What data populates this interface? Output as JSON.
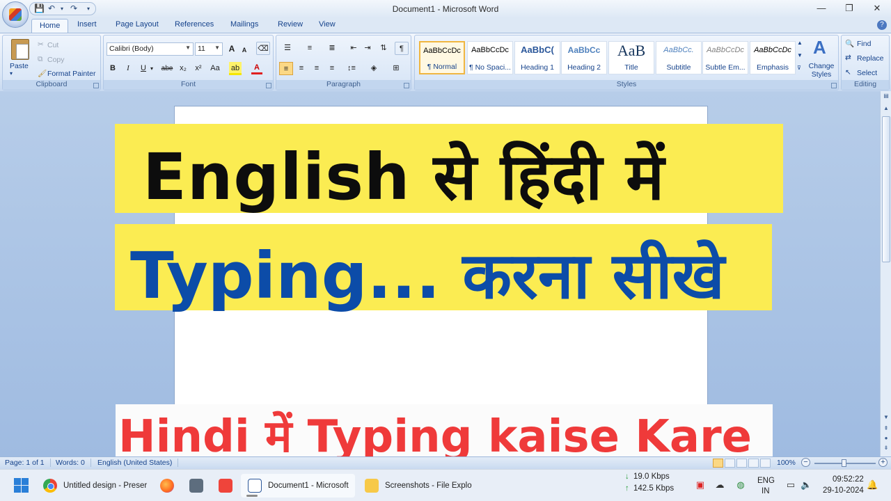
{
  "window": {
    "title": "Document1 - Microsoft Word",
    "minimize_glyph": "—",
    "maximize_glyph": "❐",
    "close_glyph": "✕"
  },
  "tabs": [
    "Home",
    "Insert",
    "Page Layout",
    "References",
    "Mailings",
    "Review",
    "View"
  ],
  "clipboard": {
    "paste": "Paste",
    "cut": "Cut",
    "copy": "Copy",
    "format_painter": "Format Painter",
    "label": "Clipboard"
  },
  "font": {
    "family": "Calibri (Body)",
    "size": "11",
    "grow": "A",
    "shrink": "A",
    "bold": "B",
    "italic": "I",
    "underline": "U",
    "strikethrough": "abe",
    "subscript": "x₂",
    "superscript": "x²",
    "change_case": "Aa",
    "font_color": "A",
    "label": "Font"
  },
  "paragraph": {
    "label": "Paragraph",
    "pilcrow": "¶"
  },
  "styles": {
    "items": [
      {
        "sample": "AaBbCcDc",
        "name": "¶ Normal"
      },
      {
        "sample": "AaBbCcDc",
        "name": "¶ No Spaci..."
      },
      {
        "sample": "AaBbC(",
        "name": "Heading 1"
      },
      {
        "sample": "AaBbCc",
        "name": "Heading 2"
      },
      {
        "sample": "AaB",
        "name": "Title"
      },
      {
        "sample": "AaBbCc.",
        "name": "Subtitle"
      },
      {
        "sample": "AaBbCcDc",
        "name": "Subtle Em..."
      },
      {
        "sample": "AaBbCcDc",
        "name": "Emphasis"
      }
    ],
    "change_styles": "Change Styles",
    "label": "Styles"
  },
  "editing": {
    "find": "Find",
    "replace": "Replace",
    "select": "Select",
    "label": "Editing"
  },
  "overlay": {
    "line1": "English  से  हिंदी  में",
    "line2": "Typing...  करना सीखे",
    "line3": "Hindi  में  Typing kaise  Kare"
  },
  "status": {
    "page": "Page: 1 of 1",
    "words": "Words: 0",
    "language": "English (United States)",
    "zoom": "100%"
  },
  "taskbar": {
    "apps": [
      {
        "label": "Untitled design - Preser"
      },
      {
        "label": "Document1 - Microsoft"
      },
      {
        "label": "Screenshots - File Explo"
      }
    ],
    "net_down": "19.0 Kbps",
    "net_up": "142.5 Kbps",
    "lang1": "ENG",
    "lang2": "IN",
    "time": "09:52:22",
    "date": "29-10-2024"
  },
  "colors": {
    "banner_yellow": "#fbec52",
    "line1_text": "#0d0d0d",
    "line2_text": "#0c4ca8",
    "line3_text": "#ef3a3a"
  }
}
